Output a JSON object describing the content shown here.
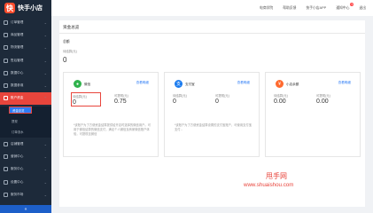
{
  "app": {
    "logo_mark": "快",
    "name": "快手小店"
  },
  "sidebar": {
    "items": [
      {
        "label": "订单管理",
        "icon": "order-icon",
        "arrow": "⌄"
      },
      {
        "label": "商品管理",
        "icon": "goods-icon",
        "arrow": "⌄"
      },
      {
        "label": "物流管理",
        "icon": "truck-icon",
        "arrow": "⌄"
      },
      {
        "label": "售后管理",
        "icon": "after-sales-icon",
        "arrow": "⌄"
      },
      {
        "label": "数据中心",
        "icon": "chart-icon",
        "arrow": "⌄"
      },
      {
        "label": "数据参谋",
        "icon": "analytics-icon",
        "arrow": "⌄"
      },
      {
        "label": "账户资金",
        "icon": "wallet-icon",
        "arrow": "⌃"
      }
    ],
    "subitems": [
      {
        "label": "资金总览"
      },
      {
        "label": "提现"
      },
      {
        "label": "订单流水"
      }
    ],
    "items_after": [
      {
        "label": "店铺管理",
        "icon": "shop-icon",
        "arrow": "⌄"
      },
      {
        "label": "营销中心",
        "icon": "marketing-icon",
        "arrow": "⌄"
      },
      {
        "label": "服务中心",
        "icon": "service-icon",
        "arrow": "⌄"
      },
      {
        "label": "设置中心",
        "icon": "settings-icon",
        "arrow": "⌄"
      },
      {
        "label": "服务市场",
        "icon": "market-icon",
        "arrow": "⌄"
      }
    ],
    "collapse": "«"
  },
  "header": {
    "links": [
      "电商学院",
      "帮助反馈",
      "快手小店APP",
      "通知中心",
      "退出"
    ],
    "badge": "?"
  },
  "main": {
    "title": "资金总览",
    "overall": {
      "label": "总额",
      "sub_label": "待结算(元)",
      "amount": "0"
    },
    "cards": [
      {
        "name": "微信",
        "icon": "wechat-icon",
        "icon_color": "#2fb24c",
        "link": "查看明细",
        "pending_label": "待结算(元)",
        "pending_value": "0",
        "available_label": "可提现(元)",
        "available_value": "0.75",
        "note": "*该账户为了方便资金结算提供给开店时选择的微信用户。可用于微信结算的微信支付，满足个人微信及商家微信账户体验，可提现至微信"
      },
      {
        "name": "支付宝",
        "icon": "alipay-icon",
        "icon_color": "#1a7bef",
        "link": "查看明细",
        "pending_label": "待结算(元)",
        "pending_value": "0",
        "available_label": "可提现(元)",
        "available_value": "0",
        "note": "*该账户为了方便资金结算设置的支付宝账户，可使用支付宝支付..."
      },
      {
        "name": "小店余额",
        "icon": "balance-icon",
        "icon_color": "#ff6a2f",
        "link": "查看明细",
        "pending_label": "待结算(元)",
        "pending_value": "0.00",
        "available_label": "可提现(元)",
        "available_value": "0.00",
        "note": ""
      }
    ]
  },
  "watermark": {
    "cn": "甩手网",
    "en": "www.shuaishou.com"
  }
}
